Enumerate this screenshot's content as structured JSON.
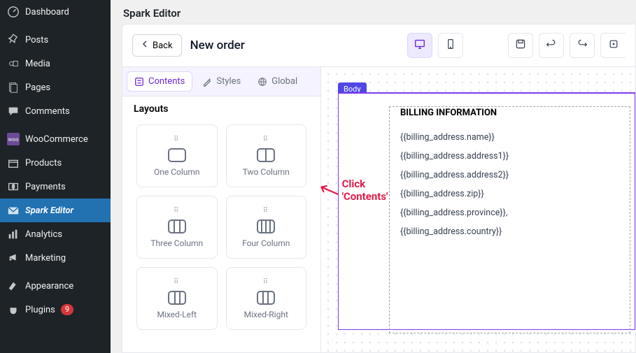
{
  "sidebar": {
    "items": [
      {
        "label": "Dashboard",
        "icon": "dashboard"
      },
      {
        "label": "Posts",
        "icon": "pin"
      },
      {
        "label": "Media",
        "icon": "media"
      },
      {
        "label": "Pages",
        "icon": "page"
      },
      {
        "label": "Comments",
        "icon": "comment"
      },
      {
        "label": "WooCommerce",
        "icon": "woo"
      },
      {
        "label": "Products",
        "icon": "products"
      },
      {
        "label": "Payments",
        "icon": "payments"
      },
      {
        "label": "Spark Editor",
        "icon": "mail",
        "active": true
      },
      {
        "label": "Analytics",
        "icon": "analytics"
      },
      {
        "label": "Marketing",
        "icon": "marketing"
      },
      {
        "label": "Appearance",
        "icon": "appearance"
      },
      {
        "label": "Plugins",
        "icon": "plugin",
        "badge": "9"
      }
    ]
  },
  "page_title": "Spark Editor",
  "topbar": {
    "back_label": "Back",
    "order_title": "New order"
  },
  "tabs": {
    "contents": "Contents",
    "styles": "Styles",
    "global": "Global"
  },
  "annotation_text": "Click 'Contents'",
  "layouts_label": "Layouts",
  "layouts": [
    {
      "label": "One Column"
    },
    {
      "label": "Two Column"
    },
    {
      "label": "Three Column"
    },
    {
      "label": "Four Column"
    },
    {
      "label": "Mixed-Left"
    },
    {
      "label": "Mixed-Right"
    }
  ],
  "canvas": {
    "body_chip": "Body",
    "section_title": "BILLING INFORMATION",
    "fields": [
      "{{billing_address.name}}",
      "{{billing_address.address1}}",
      "{{billing_address.address2}}",
      "{{billing_address.zip}}",
      "{{billing_address.province}},",
      "{{billing_address.country}}"
    ]
  }
}
